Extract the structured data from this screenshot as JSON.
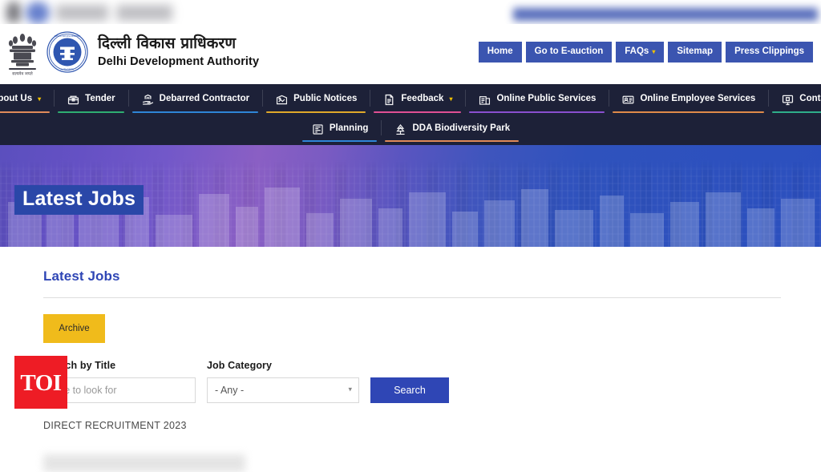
{
  "site": {
    "brand_hindi": "दिल्ली विकास प्राधिकरण",
    "brand_english": "Delhi Development Authority",
    "emblem_icon": "india-state-emblem-icon",
    "logo_icon": "dda-logo-icon"
  },
  "topnav": {
    "items": [
      {
        "label": "Home",
        "has_caret": false
      },
      {
        "label": "Go to E-auction",
        "has_caret": false
      },
      {
        "label": "FAQs",
        "has_caret": true
      },
      {
        "label": "Sitemap",
        "has_caret": false
      },
      {
        "label": "Press Clippings",
        "has_caret": false
      }
    ],
    "caret_glyph": "▾",
    "bg_color": "#3b55b0"
  },
  "mainnav": {
    "bg_color": "#1d2138",
    "row1": [
      {
        "label": "About Us",
        "icon": "home-icon",
        "caret": true,
        "bar_color": "#e08a5a"
      },
      {
        "label": "Tender",
        "icon": "tender-box-icon",
        "caret": false,
        "bar_color": "#2fae72"
      },
      {
        "label": "Debarred Contractor",
        "icon": "hand-building-icon",
        "caret": false,
        "bar_color": "#2f86d8"
      },
      {
        "label": "Public Notices",
        "icon": "notice-board-icon",
        "caret": false,
        "bar_color": "#e0a92a"
      },
      {
        "label": "Feedback",
        "icon": "document-icon",
        "caret": true,
        "bar_color": "#e04f94"
      },
      {
        "label": "Online Public Services",
        "icon": "services-icon",
        "caret": false,
        "bar_color": "#8a4fd0"
      },
      {
        "label": "Online Employee Services",
        "icon": "employee-icon",
        "caret": false,
        "bar_color": "#e08a4a"
      },
      {
        "label": "Contact Us",
        "icon": "monitor-icon",
        "caret": false,
        "bar_color": "#2fae8a"
      }
    ],
    "row2": [
      {
        "label": "Planning",
        "icon": "planning-icon",
        "caret": false,
        "bar_color": "#2f86d8"
      },
      {
        "label": "DDA Biodiversity Park",
        "icon": "park-icon",
        "caret": false,
        "bar_color": "#e08a5a"
      }
    ]
  },
  "hero": {
    "title": "Latest Jobs",
    "badge_color": "#2a47a8"
  },
  "panel": {
    "title": "Latest Jobs",
    "archive_label": "Archive",
    "archive_color": "#f0bb1b",
    "search_title_label": "Search by Title",
    "search_title_placeholder": "Title to look for",
    "search_title_value": "",
    "job_category_label": "Job Category",
    "job_category_value": "- Any -",
    "job_category_caret": "▾",
    "search_button_label": "Search",
    "search_button_color": "#2f46b5",
    "result_heading": "DIRECT RECRUITMENT 2023"
  },
  "watermark": {
    "label": "TOI",
    "color": "#ee1c25"
  }
}
